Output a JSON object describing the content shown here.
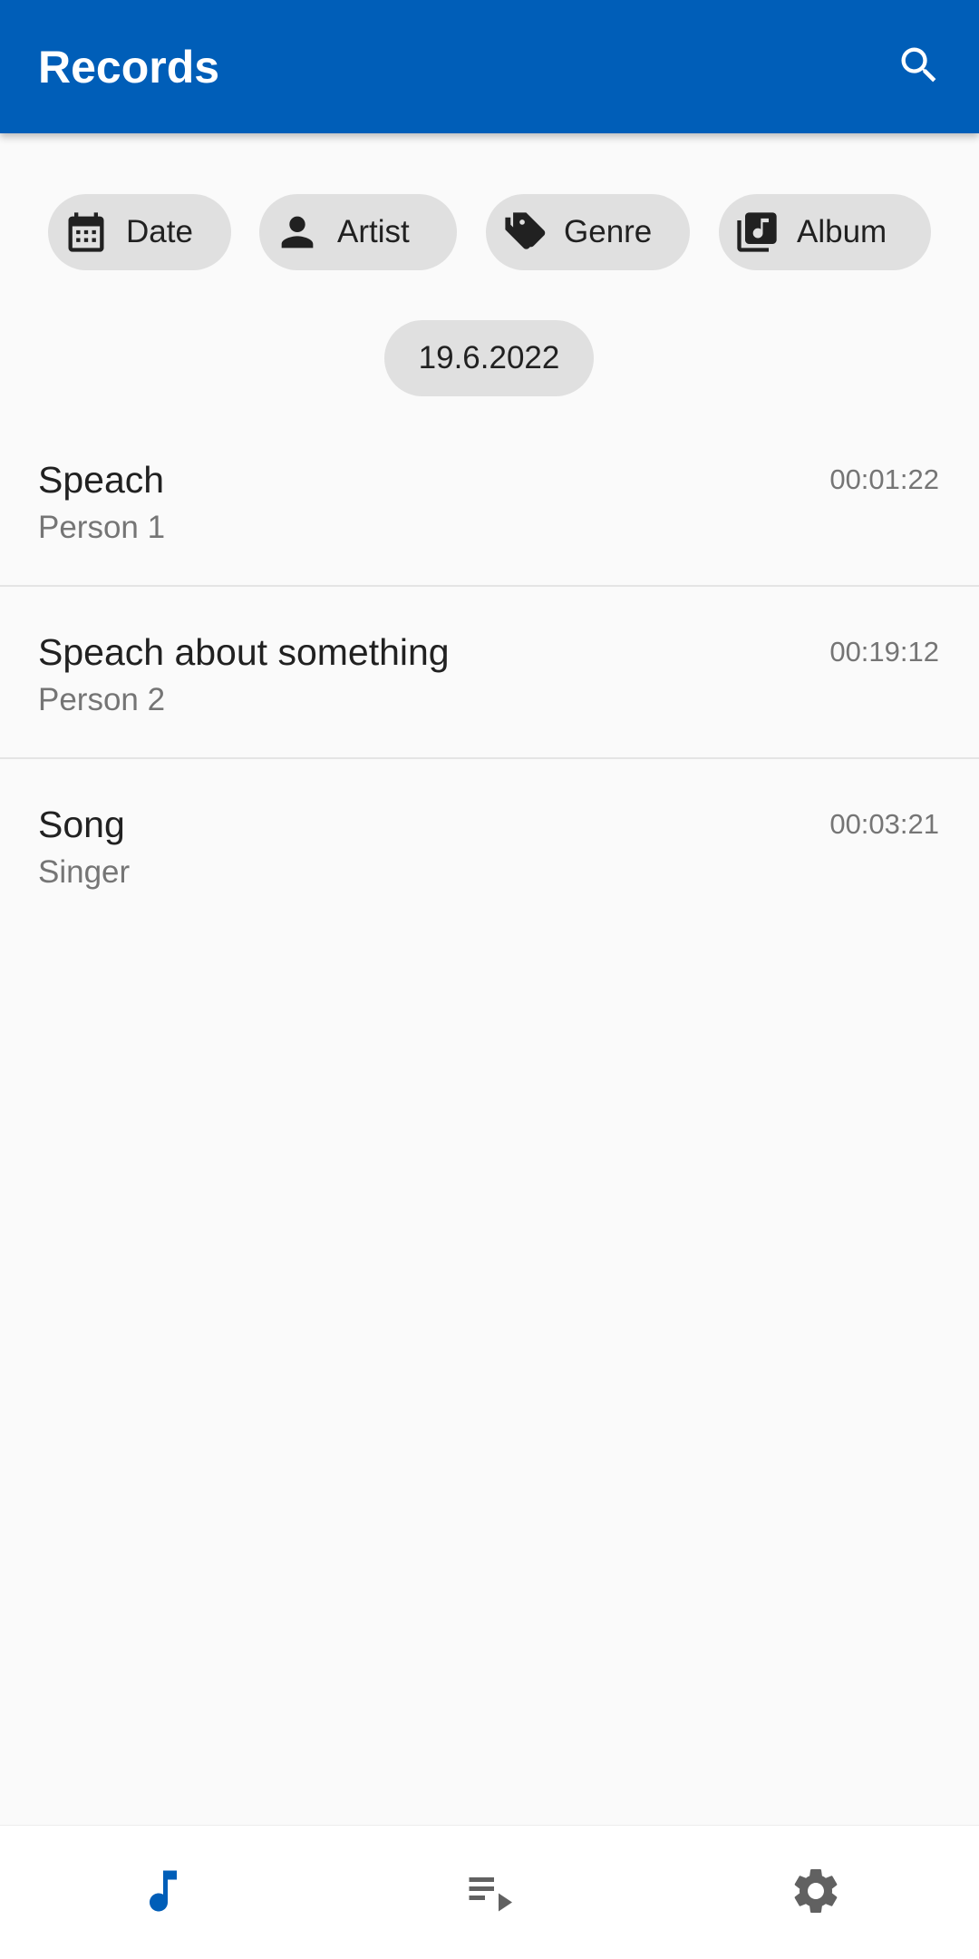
{
  "app_bar": {
    "title": "Records",
    "background_color": "#005eb8",
    "search_icon": "search-icon"
  },
  "filter_chips": [
    {
      "label": "Date",
      "icon": "calendar-icon"
    },
    {
      "label": "Artist",
      "icon": "person-icon"
    },
    {
      "label": "Genre",
      "icon": "tag-icon"
    },
    {
      "label": "Album",
      "icon": "album-icon"
    }
  ],
  "date_header": "19.6.2022",
  "records": [
    {
      "title": "Speach",
      "artist": "Person 1",
      "duration": "00:01:22"
    },
    {
      "title": "Speach about something",
      "artist": "Person 2",
      "duration": "00:19:12"
    },
    {
      "title": "Song",
      "artist": "Singer",
      "duration": "00:03:21"
    }
  ],
  "bottom_nav": {
    "items": [
      {
        "icon": "music-note-icon",
        "active": true
      },
      {
        "icon": "playlist-play-icon",
        "active": false
      },
      {
        "icon": "settings-gear-icon",
        "active": false
      }
    ],
    "active_color": "#005eb8",
    "inactive_color": "#616161"
  }
}
